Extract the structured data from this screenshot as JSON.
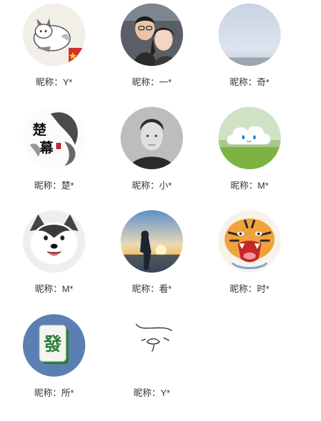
{
  "users": [
    {
      "nickname": "昵称：Y*",
      "avatar_icon": "cartoon-husky-avatar-icon"
    },
    {
      "nickname": "昵称：一*",
      "avatar_icon": "couple-selfie-avatar-icon"
    },
    {
      "nickname": "昵称：奇*",
      "avatar_icon": "sky-horizon-avatar-icon"
    },
    {
      "nickname": "昵称：楚*",
      "avatar_icon": "ink-calligraphy-avatar-icon"
    },
    {
      "nickname": "昵称：小*",
      "avatar_icon": "man-portrait-avatar-icon"
    },
    {
      "nickname": "昵称：M*",
      "avatar_icon": "cloud-on-grass-avatar-icon"
    },
    {
      "nickname": "昵称：M*",
      "avatar_icon": "smiling-husky-avatar-icon"
    },
    {
      "nickname": "昵称：看*",
      "avatar_icon": "sunset-silhouette-avatar-icon"
    },
    {
      "nickname": "昵称：时*",
      "avatar_icon": "roaring-tiger-avatar-icon"
    },
    {
      "nickname": "昵称：所*",
      "avatar_icon": "mahjong-tile-avatar-icon"
    },
    {
      "nickname": "昵称：Y*",
      "avatar_icon": "sketch-face-avatar-icon"
    }
  ],
  "avatar_texts": {
    "ink_title_1": "楚",
    "ink_title_2": "幕",
    "mahjong_glyph": "發"
  },
  "colors": {
    "nickname_text": "#333333",
    "mahjong_bg": "#5b7fb3",
    "mahjong_green": "#2e7d3a",
    "seal_red": "#c62828"
  }
}
